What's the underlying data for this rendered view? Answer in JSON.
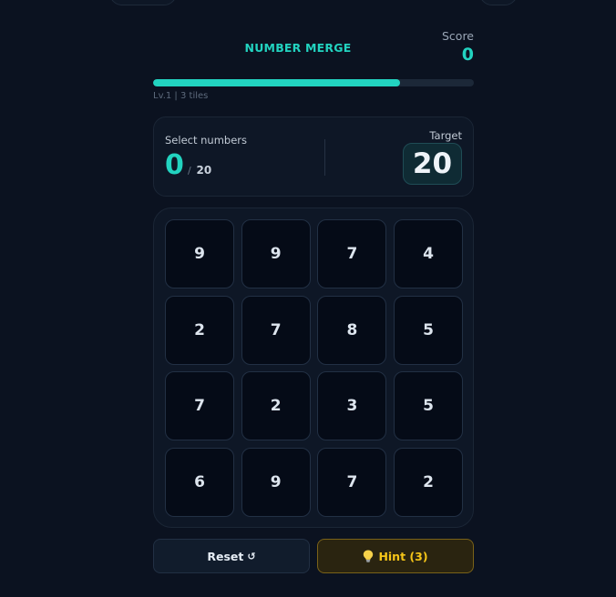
{
  "app": {
    "title": "NUMBER MERGE"
  },
  "score": {
    "label": "Score",
    "value": "0"
  },
  "progress": {
    "fraction": 0.77
  },
  "level": {
    "text": "Lv.1 | 3 tiles"
  },
  "selection": {
    "label": "Select numbers",
    "current": "0",
    "slash": "/",
    "total": "20"
  },
  "target": {
    "label": "Target",
    "value": "20"
  },
  "grid": {
    "rows": [
      [
        "9",
        "9",
        "7",
        "4"
      ],
      [
        "2",
        "7",
        "8",
        "5"
      ],
      [
        "7",
        "2",
        "3",
        "5"
      ],
      [
        "6",
        "9",
        "7",
        "2"
      ]
    ]
  },
  "actions": {
    "reset_label": "Reset",
    "reset_icon": "↺",
    "hint_label": "Hint (3)"
  },
  "colors": {
    "accent": "#22d3c0",
    "hint": "#f5c518",
    "background": "#0b1220"
  },
  "icons": {
    "reset": "reset-icon",
    "hint": "lightbulb-icon"
  }
}
